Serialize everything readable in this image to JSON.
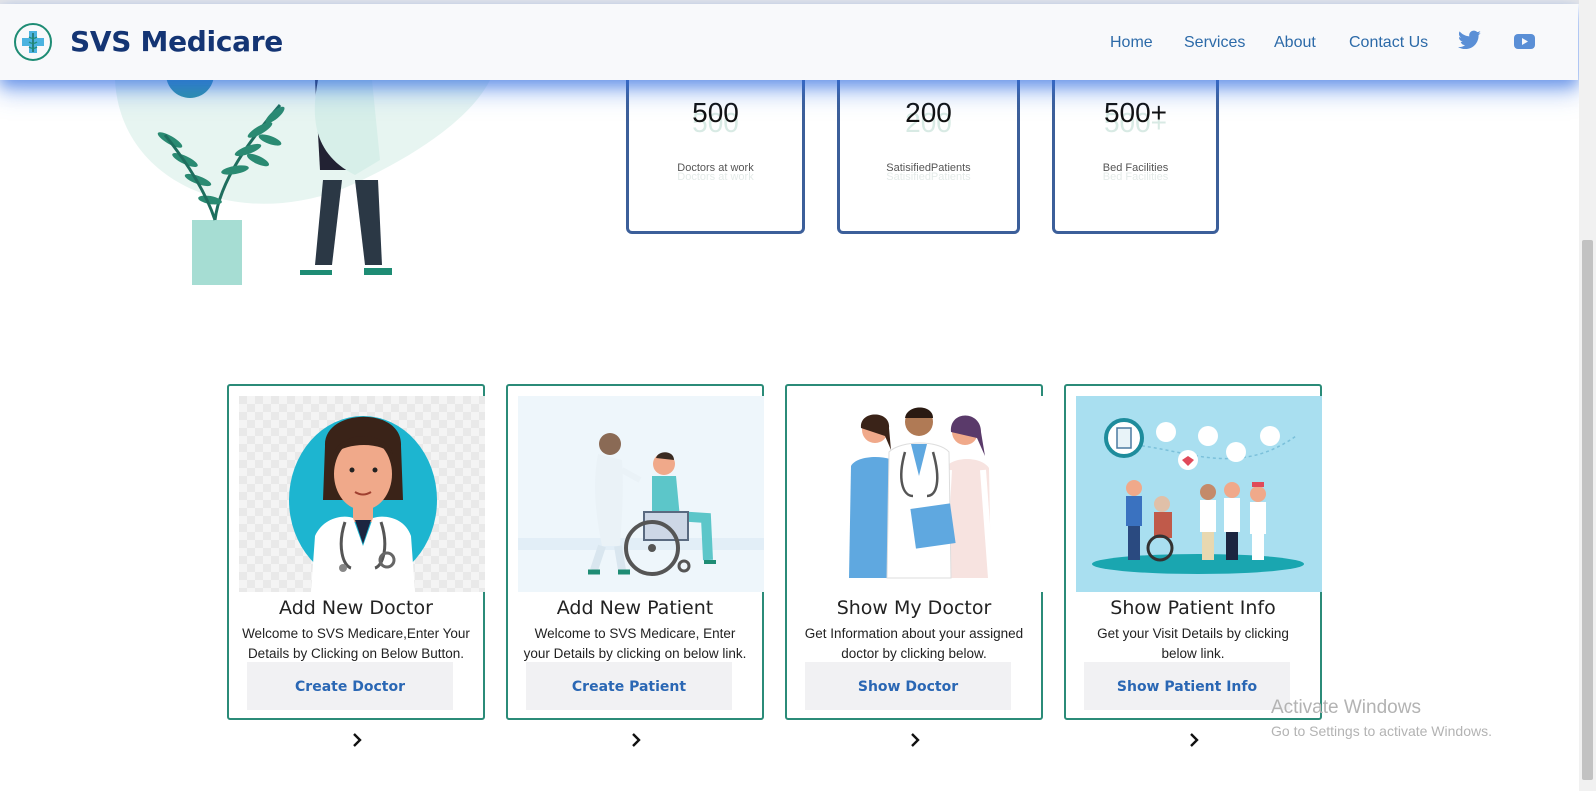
{
  "brand": {
    "name": "SVS Medicare",
    "logo": "caduceus-logo"
  },
  "nav": {
    "items": [
      "Home",
      "Services",
      "About",
      "Contact Us"
    ],
    "social": [
      "twitter-icon",
      "youtube-icon"
    ]
  },
  "stats": [
    {
      "value": "500",
      "label": "Doctors at work"
    },
    {
      "value": "200",
      "label": "SatisifiedPatients"
    },
    {
      "value": "500+",
      "label": "Bed Facilities"
    }
  ],
  "cards": [
    {
      "title": "Add New Doctor",
      "desc": "Welcome to SVS Medicare,Enter Your Details by Clicking on Below Button.",
      "button": "Create Doctor",
      "image": "female-doctor-illustration"
    },
    {
      "title": "Add New Patient",
      "desc": "Welcome to SVS Medicare, Enter your Details by clicking on below link.",
      "button": "Create Patient",
      "image": "wheelchair-patient-illustration"
    },
    {
      "title": "Show My Doctor",
      "desc": "Get Information about your assigned doctor by clicking below.",
      "button": "Show Doctor",
      "image": "doctors-group-illustration"
    },
    {
      "title": "Show Patient Info",
      "desc": "Get your Visit Details by clicking below link.",
      "button": "Show Patient Info",
      "image": "patient-info-illustration"
    }
  ],
  "watermark": {
    "line1": "Activate Windows",
    "line2": "Go to Settings to activate Windows."
  },
  "colors": {
    "brand": "#143574",
    "nav_link": "#2c6aa8",
    "card_border": "#2b8b78",
    "stat_border": "#3c5f9a",
    "button_text": "#2a67b4"
  }
}
